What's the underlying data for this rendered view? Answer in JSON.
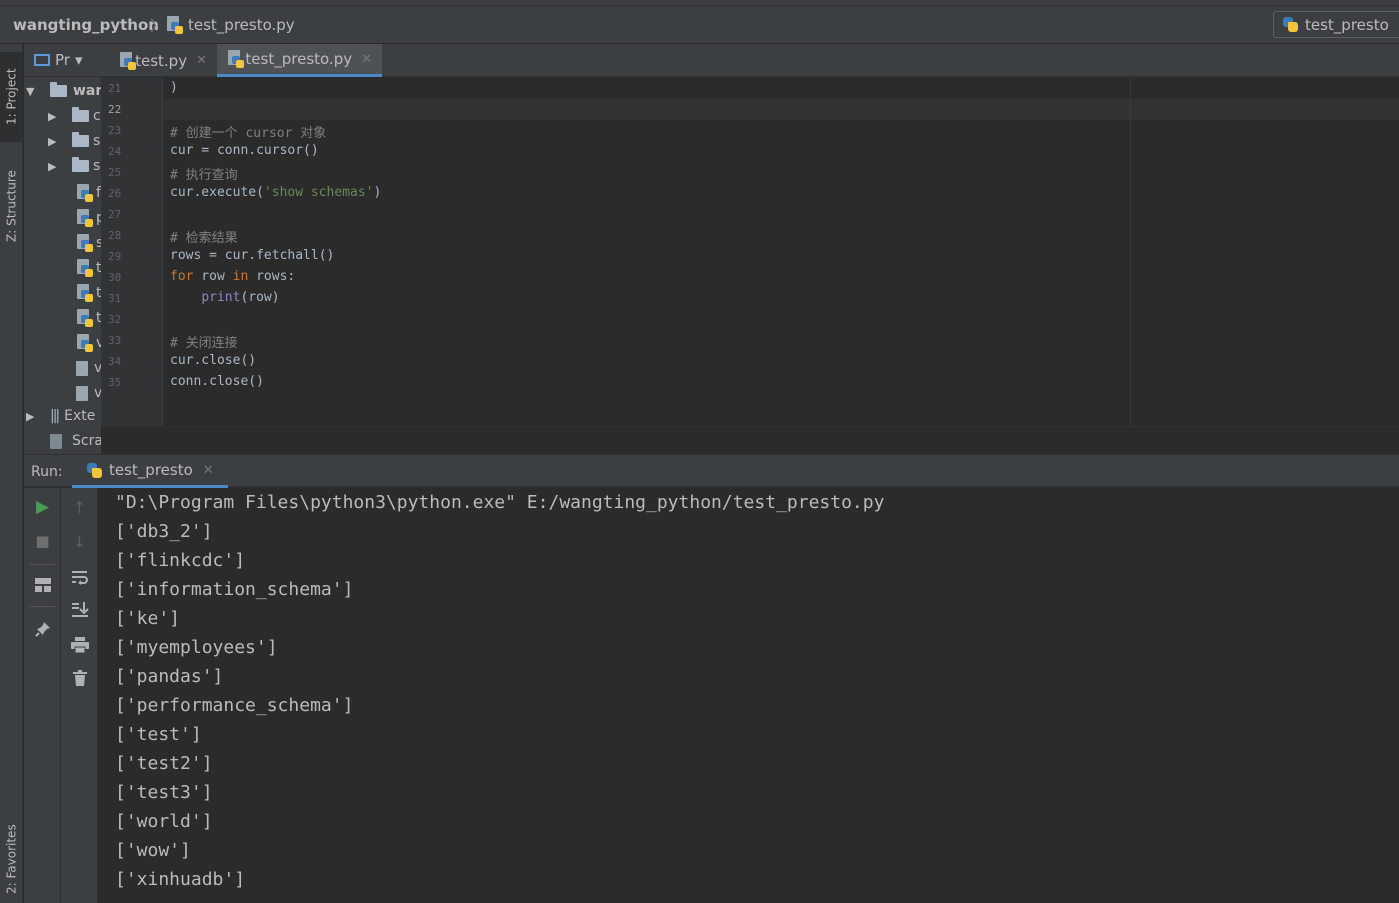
{
  "navbar": {
    "project": "wangting_python",
    "separator": "〉",
    "file": "test_presto.py",
    "run_config": "test_presto"
  },
  "tool_windows": {
    "project": "1: Project",
    "structure": "Z: Structure",
    "favorites": "2: Favorites"
  },
  "project_panel": {
    "title": "Pr",
    "dropdown": "▾",
    "root": "wan",
    "folders": [
      "c",
      "s",
      "s"
    ],
    "files": [
      "f",
      "p",
      "s",
      "t",
      "t",
      "t",
      "v",
      "v",
      "v"
    ],
    "external": "Exte",
    "scratches": "Scra"
  },
  "editor": {
    "tabs": [
      {
        "label": "test.py",
        "close": "✕"
      },
      {
        "label": "test_presto.py",
        "close": "✕"
      }
    ],
    "line_numbers": [
      "21",
      "22",
      "23",
      "24",
      "25",
      "26",
      "27",
      "28",
      "29",
      "30",
      "31",
      "32",
      "33",
      "34",
      "35"
    ],
    "current_line": "22"
  },
  "run": {
    "label": "Run:",
    "tab": "test_presto",
    "tab_close": "✕",
    "console": [
      "\"D:\\Program Files\\python3\\python.exe\" E:/wangting_python/test_presto.py",
      "['db3_2']",
      "['flinkcdc']",
      "['information_schema']",
      "['ke']",
      "['myemployees']",
      "['pandas']",
      "['performance_schema']",
      "['test']",
      "['test2']",
      "['test3']",
      "['world']",
      "['wow']",
      "['xinhuadb']"
    ]
  },
  "toolbar_icons": [
    "run-icon",
    "stop-icon",
    "layout-icon",
    "pin-icon",
    "up-arrow-icon",
    "down-arrow-icon",
    "soft-wrap-icon",
    "scroll-end-icon",
    "print-icon",
    "trash-icon"
  ],
  "colors": {
    "accent": "#4a88c7",
    "run_green": "#499c54",
    "keyword": "#cc7832",
    "string": "#6a8759",
    "comment": "#808080"
  }
}
